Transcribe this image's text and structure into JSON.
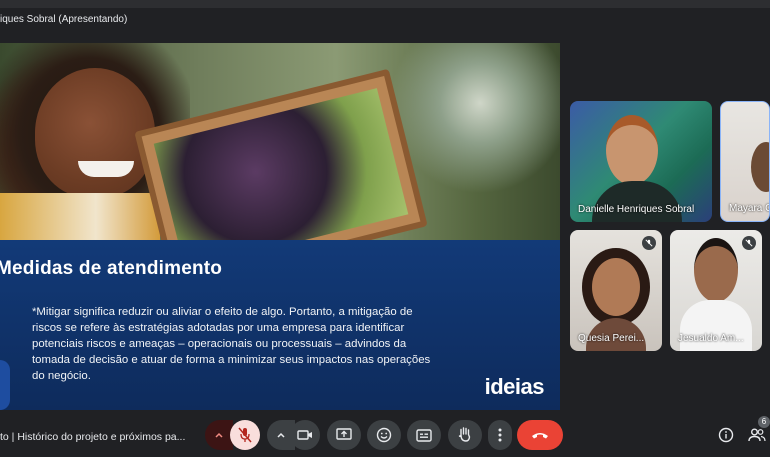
{
  "window": {
    "title": "iques Sobral (Apresentando)"
  },
  "slide": {
    "heading": "Medidas de atendimento",
    "body": "*Mitigar significa reduzir ou aliviar o efeito de algo. Portanto, a mitigação de riscos se refere às estratégias adotadas por uma empresa para identificar potenciais riscos e ameaças – operacionais ou processuais – advindos da tomada de decisão e atuar de forma a minimizar seus impactos nas operações do negócio.",
    "logo": "ideias"
  },
  "participants": [
    {
      "name": "Danielle Henriques Sobral",
      "muted": false
    },
    {
      "name": "Mayara C",
      "muted": false
    },
    {
      "name": "Quesia Perei...",
      "muted": true
    },
    {
      "name": "Jesualdo Am...",
      "muted": true
    }
  ],
  "controls": {
    "meeting_title": "to | Histórico do projeto e próximos pa...",
    "participant_count": "6",
    "icons": [
      "chevron-up-icon",
      "mic-off-icon",
      "chevron-up-icon",
      "camera-icon",
      "present-icon",
      "emoji-icon",
      "captions-icon",
      "raise-hand-icon",
      "more-icon",
      "end-call-icon",
      "info-icon",
      "people-icon"
    ],
    "colors": {
      "end_call": "#ea4335",
      "mic_off_bg": "#f9dedc",
      "toolbar_bg": "#3c4043"
    }
  }
}
